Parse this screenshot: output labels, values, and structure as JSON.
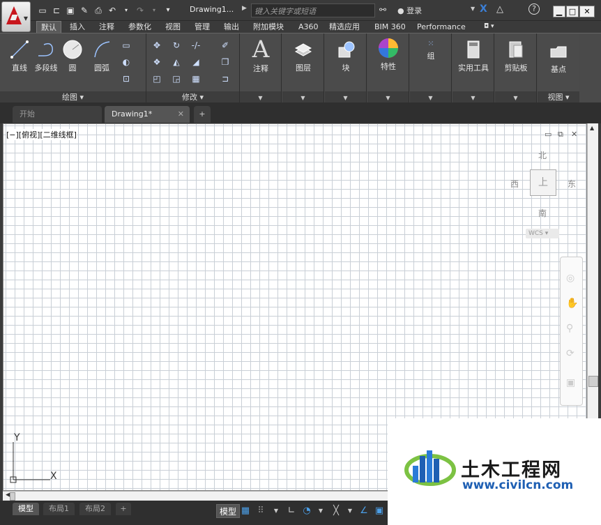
{
  "titlebar": {
    "doc_title": "Drawing1...",
    "search_placeholder": "键入关键字或短语",
    "login": "登录",
    "help": "?",
    "win_min": "▁",
    "win_max": "□",
    "win_close": "✕"
  },
  "ribbon_tabs": [
    "默认",
    "插入",
    "注释",
    "参数化",
    "视图",
    "管理",
    "输出",
    "附加模块",
    "A360",
    "精选应用",
    "BIM 360",
    "Performance"
  ],
  "panels": {
    "draw": {
      "label": "绘图 ▾",
      "line": "直线",
      "polyline": "多段线",
      "circle": "圆",
      "arc": "圆弧"
    },
    "modify": {
      "label": "修改 ▾"
    },
    "annotation": {
      "label": "注释"
    },
    "layers": {
      "label": "图层"
    },
    "block": {
      "label": "块"
    },
    "properties": {
      "label": "特性"
    },
    "groups": {
      "label": "组"
    },
    "utilities": {
      "label": "实用工具"
    },
    "clipboard": {
      "label": "剪贴板"
    },
    "view": {
      "label": "基点",
      "foot": "视图 ▾"
    }
  },
  "file_tabs": {
    "start": "开始",
    "drawing": "Drawing1*",
    "close": "✕",
    "new": "+"
  },
  "viewport": {
    "label": "[−][俯视][二维线框]",
    "compass": {
      "north": "北",
      "south": "南",
      "east": "东",
      "west": "西",
      "top": "上"
    },
    "wcs": "WCS ▾",
    "ucs_x": "X",
    "ucs_y": "Y"
  },
  "layout_tabs": {
    "model": "模型",
    "layout1": "布局1",
    "layout2": "布局2",
    "add": "+"
  },
  "status": {
    "model": "模型"
  },
  "watermark": {
    "title": "土木工程网",
    "url": "www.civilcn.com"
  }
}
